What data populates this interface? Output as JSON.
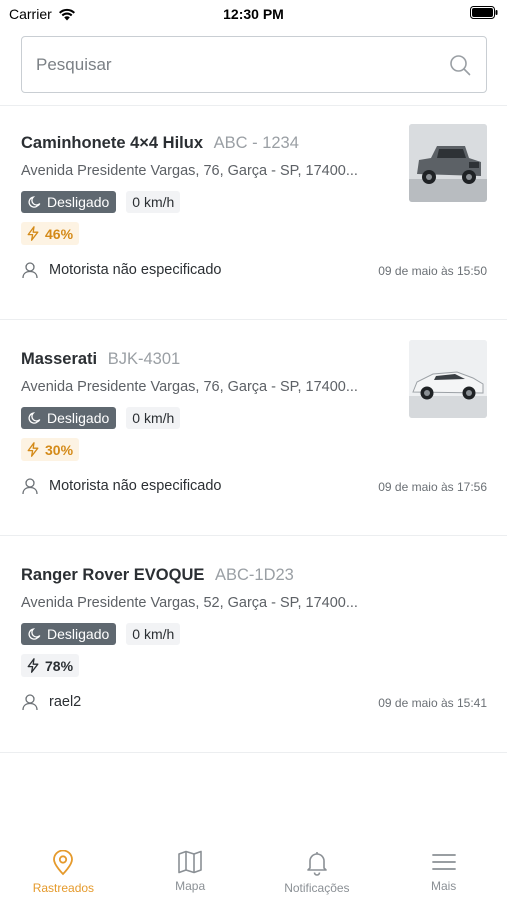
{
  "status_bar": {
    "carrier": "Carrier",
    "time": "12:30 PM"
  },
  "search": {
    "placeholder": "Pesquisar",
    "value": ""
  },
  "vehicles": [
    {
      "name": "Caminhonete 4×4 Hilux",
      "plate": "ABC - 1234",
      "address": "Avenida Presidente Vargas, 76, Garça - SP, 17400...",
      "status": "Desligado",
      "speed": "0 km/h",
      "battery": "46%",
      "battery_state": "warn",
      "driver": "Motorista não especificado",
      "timestamp": "09 de maio às 15:50",
      "has_photo": true
    },
    {
      "name": "Masserati",
      "plate": "BJK-4301",
      "address": "Avenida Presidente Vargas, 76, Garça - SP, 17400...",
      "status": "Desligado",
      "speed": "0 km/h",
      "battery": "30%",
      "battery_state": "warn",
      "driver": "Motorista não especificado",
      "timestamp": "09 de maio às 17:56",
      "has_photo": true
    },
    {
      "name": "Ranger Rover EVOQUE",
      "plate": "ABC-1D23",
      "address": "Avenida Presidente Vargas, 52, Garça - SP, 17400...",
      "status": "Desligado",
      "speed": "0 km/h",
      "battery": "78%",
      "battery_state": "ok",
      "driver": "rael2",
      "timestamp": "09 de maio às 15:41",
      "has_photo": false
    }
  ],
  "nav": [
    {
      "label": "Rastreados",
      "icon": "location-pin-icon",
      "active": true
    },
    {
      "label": "Mapa",
      "icon": "map-icon",
      "active": false
    },
    {
      "label": "Notificações",
      "icon": "bell-icon",
      "active": false
    },
    {
      "label": "Mais",
      "icon": "menu-icon",
      "active": false
    }
  ],
  "colors": {
    "accent": "#e59a2c",
    "badge_off": "#5f6870",
    "battery_warn": "#d48a18"
  }
}
